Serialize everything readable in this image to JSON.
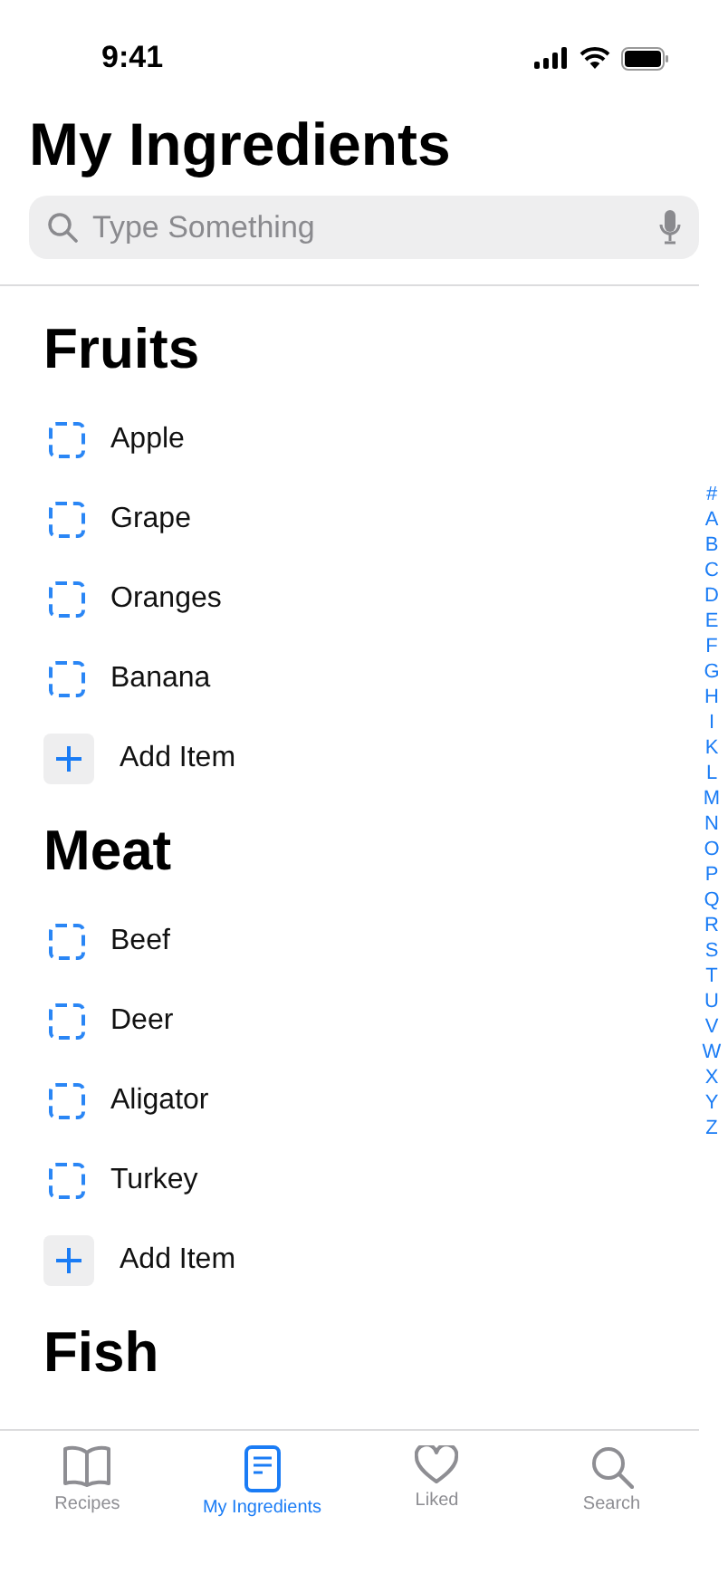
{
  "status_bar": {
    "time": "9:41"
  },
  "title": "My Ingredients",
  "search": {
    "placeholder": "Type Something"
  },
  "sections": [
    {
      "title": "Fruits",
      "items": [
        {
          "label": "Apple",
          "checked": false
        },
        {
          "label": "Grape",
          "checked": false
        },
        {
          "label": "Oranges",
          "checked": false
        },
        {
          "label": "Banana",
          "checked": false
        }
      ],
      "add_label": "Add Item"
    },
    {
      "title": "Meat",
      "items": [
        {
          "label": "Beef",
          "checked": false
        },
        {
          "label": "Deer",
          "checked": false
        },
        {
          "label": "Aligator",
          "checked": false
        },
        {
          "label": "Turkey",
          "checked": false
        }
      ],
      "add_label": "Add Item"
    },
    {
      "title": "Fish"
    }
  ],
  "index": [
    "#",
    "A",
    "B",
    "C",
    "D",
    "E",
    "F",
    "G",
    "H",
    "I",
    "K",
    "L",
    "M",
    "N",
    "O",
    "P",
    "Q",
    "R",
    "S",
    "T",
    "U",
    "V",
    "W",
    "X",
    "Y",
    "Z"
  ],
  "tabs": [
    {
      "label": "Recipes",
      "selected": false
    },
    {
      "label": "My Ingredients",
      "selected": true
    },
    {
      "label": "Liked",
      "selected": false
    },
    {
      "label": "Search",
      "selected": false
    }
  ]
}
